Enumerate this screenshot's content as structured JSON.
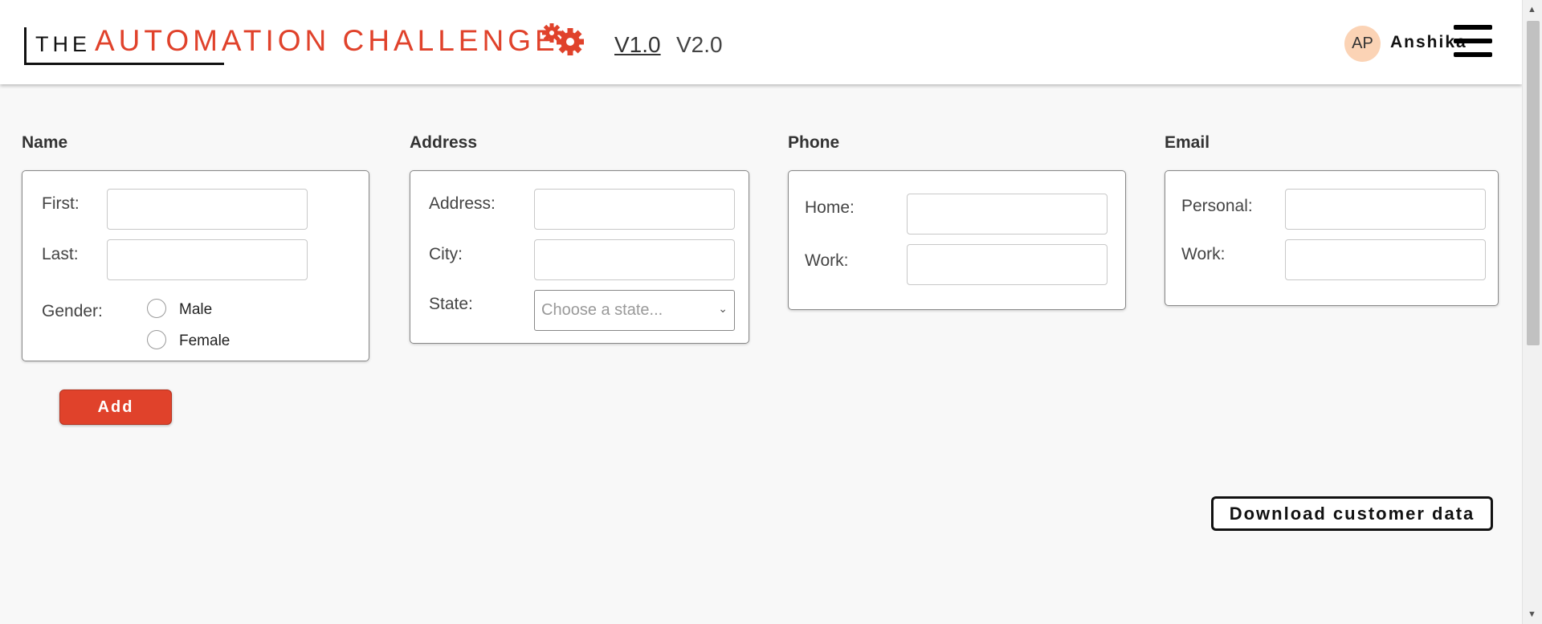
{
  "header": {
    "logo_the": "THE",
    "logo_title": "AUTOMATION CHALLENGE",
    "nav": {
      "v1": "V1.0",
      "v2": "V2.0"
    },
    "avatar_initials": "AP",
    "username": "Anshika"
  },
  "sections": {
    "name": {
      "title": "Name",
      "first_label": "First:",
      "first_value": "",
      "last_label": "Last:",
      "last_value": "",
      "gender_label": "Gender:",
      "options": [
        "Male",
        "Female"
      ]
    },
    "address": {
      "title": "Address",
      "address_label": "Address:",
      "address_value": "",
      "city_label": "City:",
      "city_value": "",
      "state_label": "State:",
      "state_placeholder": "Choose a state..."
    },
    "phone": {
      "title": "Phone",
      "home_label": "Home:",
      "home_value": "",
      "work_label": "Work:",
      "work_value": ""
    },
    "email": {
      "title": "Email",
      "personal_label": "Personal:",
      "personal_value": "",
      "work_label": "Work:",
      "work_value": ""
    }
  },
  "buttons": {
    "add": "Add",
    "download": "Download customer data"
  },
  "colors": {
    "accent": "#e0422b",
    "avatar_bg": "#fbd3b5",
    "page_bg": "#f8f8f8"
  },
  "icons": {
    "gears": "gears-icon",
    "menu": "hamburger-menu-icon",
    "select_arrow": "chevron-down-icon"
  }
}
